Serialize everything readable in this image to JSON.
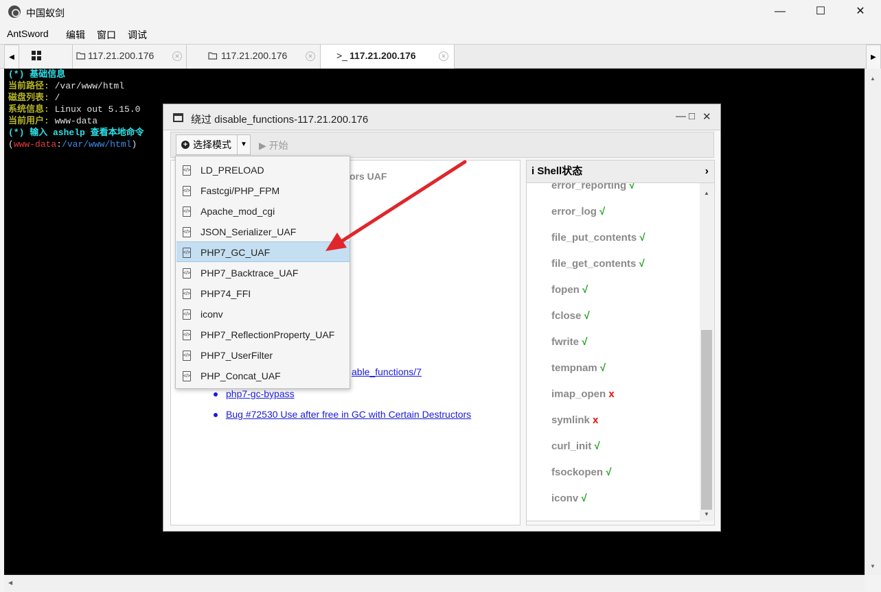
{
  "app": {
    "title": "中国蚁剑"
  },
  "window_controls": {
    "minimize": "—",
    "maximize": "☐",
    "close": "✕"
  },
  "menu": [
    "AntSword",
    "编辑",
    "窗口",
    "调试"
  ],
  "tabs": [
    {
      "label": "117.21.200.176",
      "type": "folder"
    },
    {
      "label": "117.21.200.176",
      "type": "folder"
    },
    {
      "label": "117.21.200.176",
      "type": "terminal",
      "active": true
    }
  ],
  "terminal": {
    "lines": [
      {
        "label": "(*) 基础信息",
        "value": ""
      },
      {
        "label": "当前路径:",
        "value": " /var/www/html"
      },
      {
        "label": "磁盘列表:",
        "value": " /"
      },
      {
        "label": "系统信息:",
        "value": " Linux out 5.15.0"
      },
      {
        "label": "当前用户:",
        "value": " www-data"
      },
      {
        "label": "(*) 输入 ashelp 查看本地命令",
        "value": ""
      }
    ],
    "prompt": {
      "open": "(",
      "user": "www-data",
      "sep": ":",
      "path": "/var/www/html",
      "close": ")"
    }
  },
  "dialog": {
    "title": "绕过 disable_functions-117.21.200.176",
    "controls": {
      "minimize": "—",
      "maximize": "□",
      "close": "✕"
    },
    "toolbar": {
      "mode_label": "选择模式",
      "start_label": "▶ 开始"
    },
    "left_pane": {
      "partial_title": "ors UAF",
      "links": [
        "able_functions/7",
        "php7-gc-bypass",
        "Bug #72530 Use after free in GC with Certain Destructors"
      ]
    },
    "right_pane": {
      "header_icon": "i",
      "header": "Shell状态",
      "functions": [
        {
          "name": "error_reporting",
          "status": "√",
          "ok": true
        },
        {
          "name": "error_log",
          "status": "√",
          "ok": true
        },
        {
          "name": "file_put_contents",
          "status": "√",
          "ok": true
        },
        {
          "name": "file_get_contents",
          "status": "√",
          "ok": true
        },
        {
          "name": "fopen",
          "status": "√",
          "ok": true
        },
        {
          "name": "fclose",
          "status": "√",
          "ok": true
        },
        {
          "name": "fwrite",
          "status": "√",
          "ok": true
        },
        {
          "name": "tempnam",
          "status": "√",
          "ok": true
        },
        {
          "name": "imap_open",
          "status": "x",
          "ok": false
        },
        {
          "name": "symlink",
          "status": "x",
          "ok": false
        },
        {
          "name": "curl_init",
          "status": "√",
          "ok": true
        },
        {
          "name": "fsockopen",
          "status": "√",
          "ok": true
        },
        {
          "name": "iconv",
          "status": "√",
          "ok": true
        }
      ]
    },
    "mode_menu": {
      "items": [
        "LD_PRELOAD",
        "Fastcgi/PHP_FPM",
        "Apache_mod_cgi",
        "JSON_Serializer_UAF",
        "PHP7_GC_UAF",
        "PHP7_Backtrace_UAF",
        "PHP74_FFI",
        "iconv",
        "PHP7_ReflectionProperty_UAF",
        "PHP7_UserFilter",
        "PHP_Concat_UAF"
      ],
      "selected": "PHP7_GC_UAF"
    }
  },
  "annotation_color": "#e0262b"
}
